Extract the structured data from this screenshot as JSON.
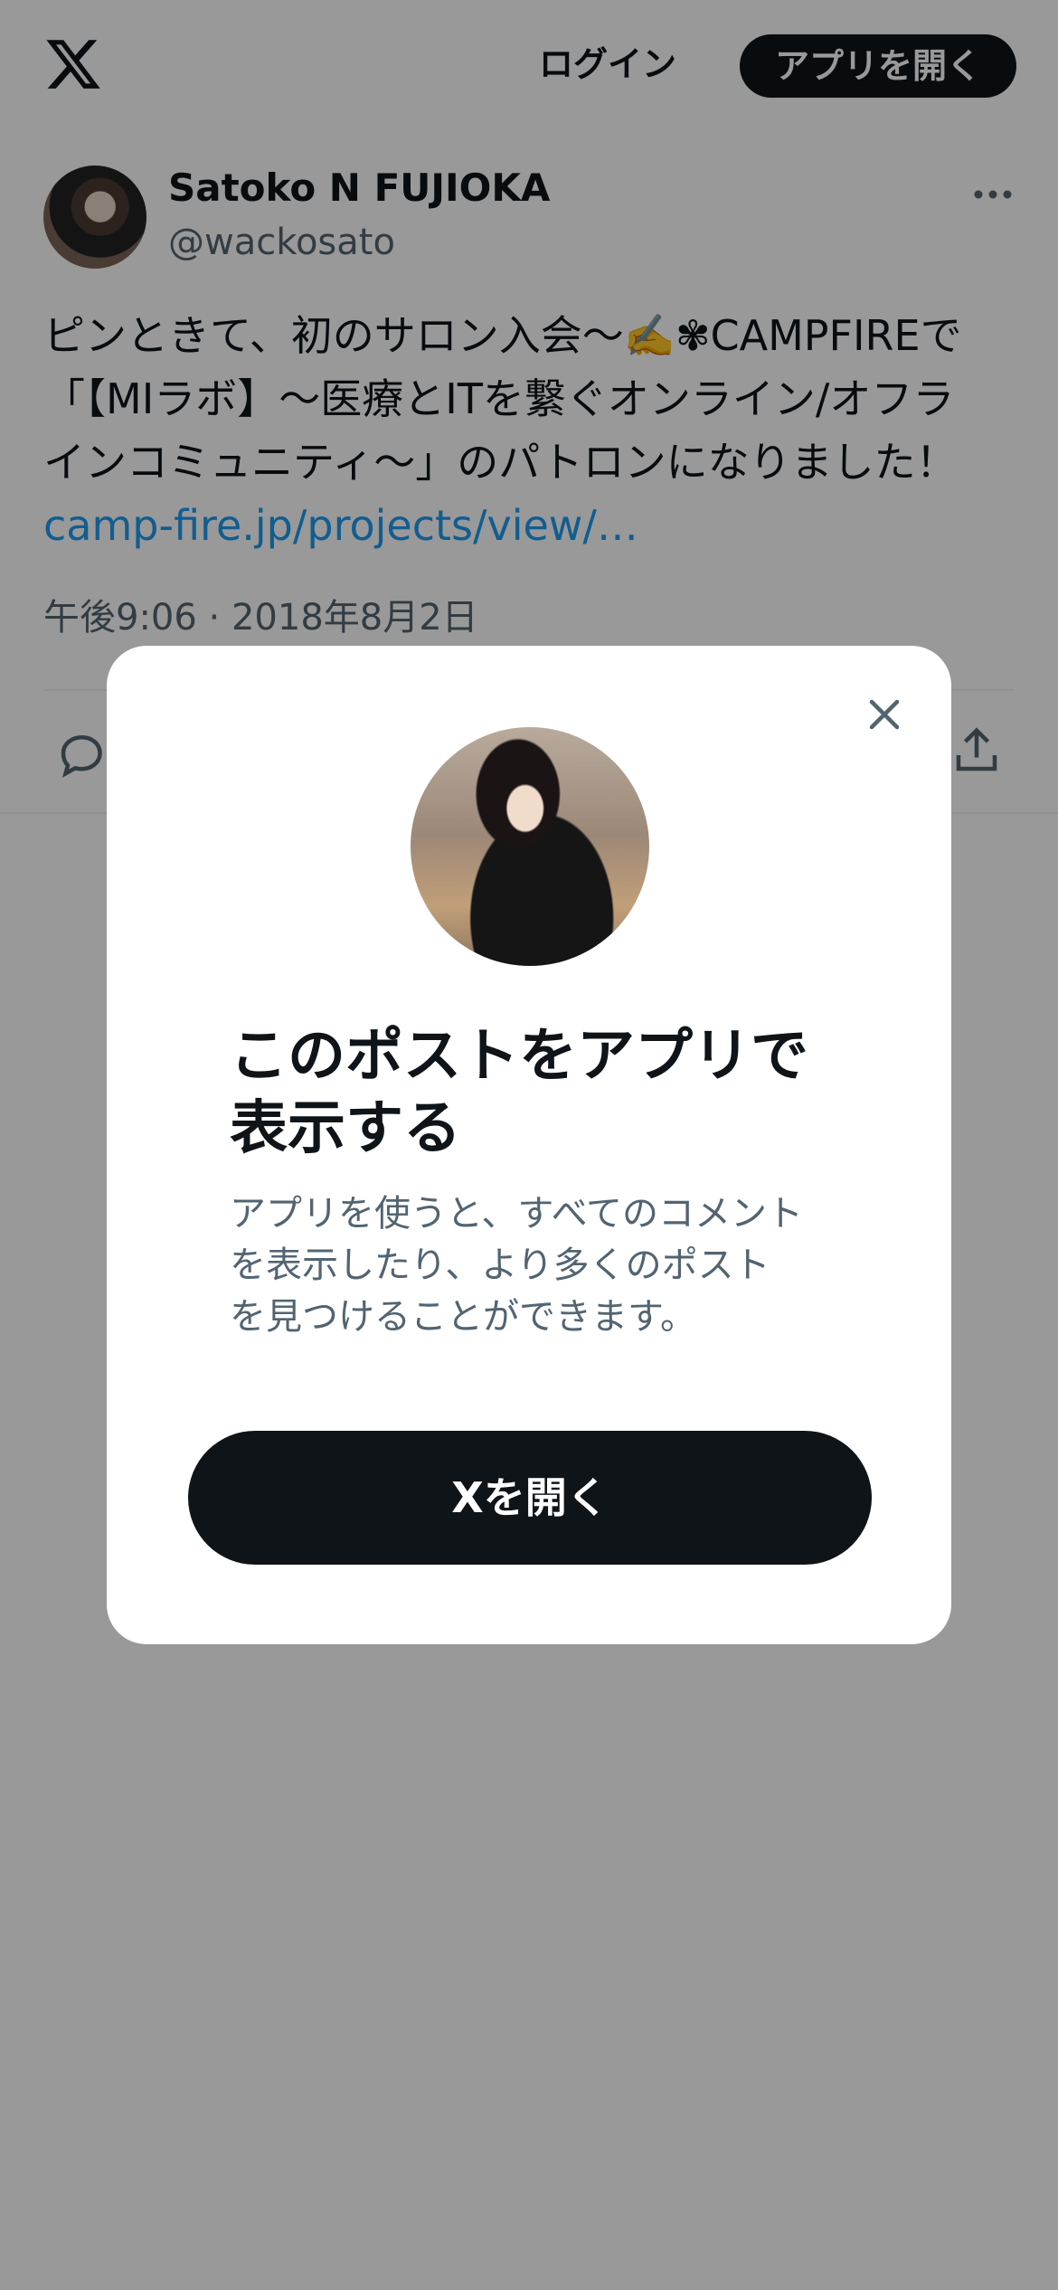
{
  "header": {
    "logo_icon": "x-logo-icon",
    "login_label": "ログイン",
    "open_app_label": "アプリを開く"
  },
  "tweet": {
    "display_name": "Satoko N FUJIOKA",
    "handle": "@wackosato",
    "text_lines": [
      "ピンときて、初のサロン入会〜✍️✾CAMPFIREで",
      "「【MIラボ】〜医療とITを繋ぐオンライン/オフラ",
      "インコミュニティ〜」のパトロンになりました！"
    ],
    "link": "camp-fire.jp/projects/view/…",
    "meta": "午後9:06 · 2018年8月2日"
  },
  "modal": {
    "title_lines": [
      "このポストをアプリで",
      "表示する"
    ],
    "description_lines": [
      "アプリを使うと、すべてのコメント",
      "を表示したり、より多くのポスト",
      "を見つけることができます。"
    ],
    "open_button_label": "Xを開く"
  },
  "colors": {
    "primary_text": "#0f1419",
    "secondary_text": "#536471",
    "link": "#1d9bf0",
    "overlay": "rgba(0,0,0,0.4)"
  }
}
